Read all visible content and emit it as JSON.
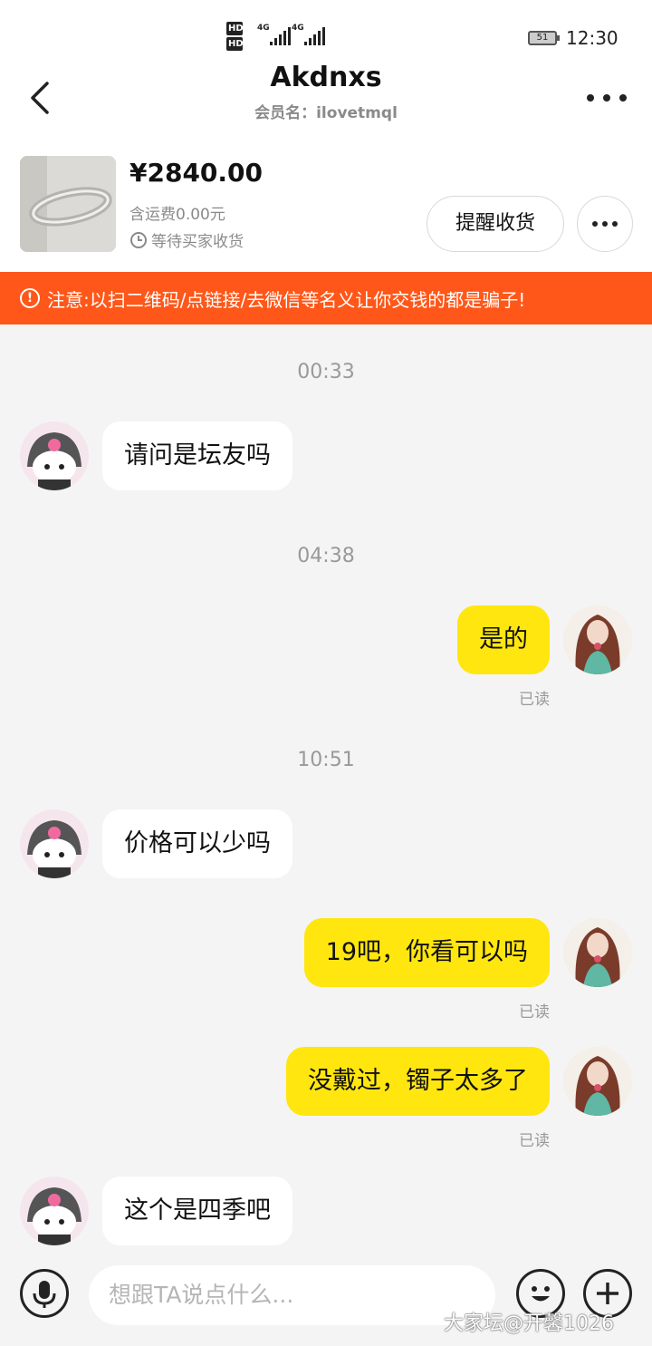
{
  "status_bar": {
    "hd1": "HD",
    "hd2": "HD",
    "net1": "4G",
    "net2": "4G",
    "battery": "51",
    "time": "12:30"
  },
  "header": {
    "title": "Akdnxs",
    "subtitle": "会员名：ilovetmql"
  },
  "product": {
    "price": "¥2840.00",
    "shipping": "含运费0.00元",
    "status": "等待买家收货",
    "remind_label": "提醒收货"
  },
  "warning": {
    "text": "注意:以扫二维码/点链接/去微信等名义让你交钱的都是骗子!"
  },
  "messages": [
    {
      "time": "00:33",
      "direction": "in",
      "text": "请问是坛友吗"
    },
    {
      "time": "04:38",
      "direction": "out",
      "text": "是的",
      "read": "已读"
    },
    {
      "time": "10:51",
      "direction": "in",
      "text": "价格可以少吗"
    },
    {
      "direction": "out",
      "text": "19吧，你看可以吗",
      "read": "已读"
    },
    {
      "direction": "out",
      "text": "没戴过，镯子太多了",
      "read": "已读"
    },
    {
      "direction": "in",
      "text": "这个是四季吧"
    }
  ],
  "input": {
    "placeholder": "想跟TA说点什么..."
  },
  "watermark": "大家坛@开馨1026",
  "colors": {
    "accent_yellow": "#ffe60f",
    "warning_orange": "#ff5719",
    "background": "#f4f4f4"
  }
}
